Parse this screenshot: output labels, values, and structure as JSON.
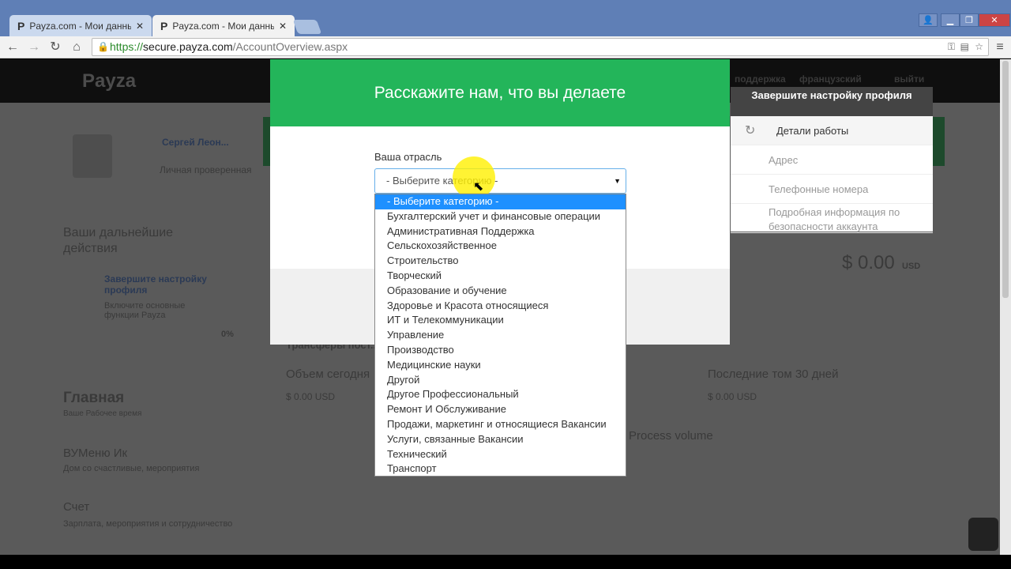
{
  "browser": {
    "tabs": [
      {
        "favicon": "P",
        "title": "Payza.com - Мои данные",
        "active": false
      },
      {
        "favicon": "P",
        "title": "Payza.com - Мои данные",
        "active": true
      }
    ],
    "close_glyph": "✕",
    "url_scheme": "https://",
    "url_host": "secure.payza.com",
    "url_path": "/AccountOverview.aspx"
  },
  "site": {
    "logo": "Payza",
    "nav": [
      "поддержка",
      "французский",
      "выйти"
    ],
    "user_name": "Сергей Леон...",
    "user_status": "Личная проверенная",
    "actions_title": "Ваши дальнейшие действия",
    "setup_link": "Завершите настройку профиля",
    "setup_sub": "Включите основные функции Payza",
    "progress_pct": "0%",
    "balance": "$ 0.00",
    "balance_cur": "USD",
    "transfers_title": "Трансферы пост...",
    "vol_today": "Объем сегодня",
    "vol_today_value": "$ 0.00 USD",
    "last30": "Последние том 30 дней",
    "last30_value": "$ 0.00 USD",
    "process_volume": "Process volume",
    "main_title": "Главная",
    "main_sub": "Ваше Рабочее время",
    "menu_item1": "ВУМеню Ик",
    "menu_item1_sub": "Дом со счастливые, мероприятия",
    "menu_item2": "Счет",
    "menu_item2_sub": "Зарплата, мероприятия и сотрудничество"
  },
  "setup_panel": {
    "header": "Завершите настройку профиля",
    "items": [
      "Детали работы",
      "Адрес",
      "Телефонные номера",
      "Подробная информация по безопасности аккаунта"
    ]
  },
  "modal": {
    "title": "Расскажите нам, что вы делаете",
    "field_label": "Ваша отрасль",
    "select_value": "- Выберите категорию -",
    "options": [
      "- Выберите категорию -",
      "Бухгалтерский учет и финансовые операции",
      "Административная Поддержка",
      "Сельскохозяйственное",
      "Строительство",
      "Творческий",
      "Образование и обучение",
      "Здоровье и Красота относящиеся",
      "ИТ и Телекоммуникации",
      "Управление",
      "Производство",
      "Медицинские науки",
      "Другой",
      "Другое Профессиональный",
      "Ремонт И Обслуживание",
      "Продажи, маркетинг и относящиеся Вакансии",
      "Услуги, связанные Вакансии",
      "Технический",
      "Транспорт"
    ],
    "selected_index": 0
  },
  "colors": {
    "accent_green": "#23b55a",
    "selected_blue": "#1e90ff"
  }
}
